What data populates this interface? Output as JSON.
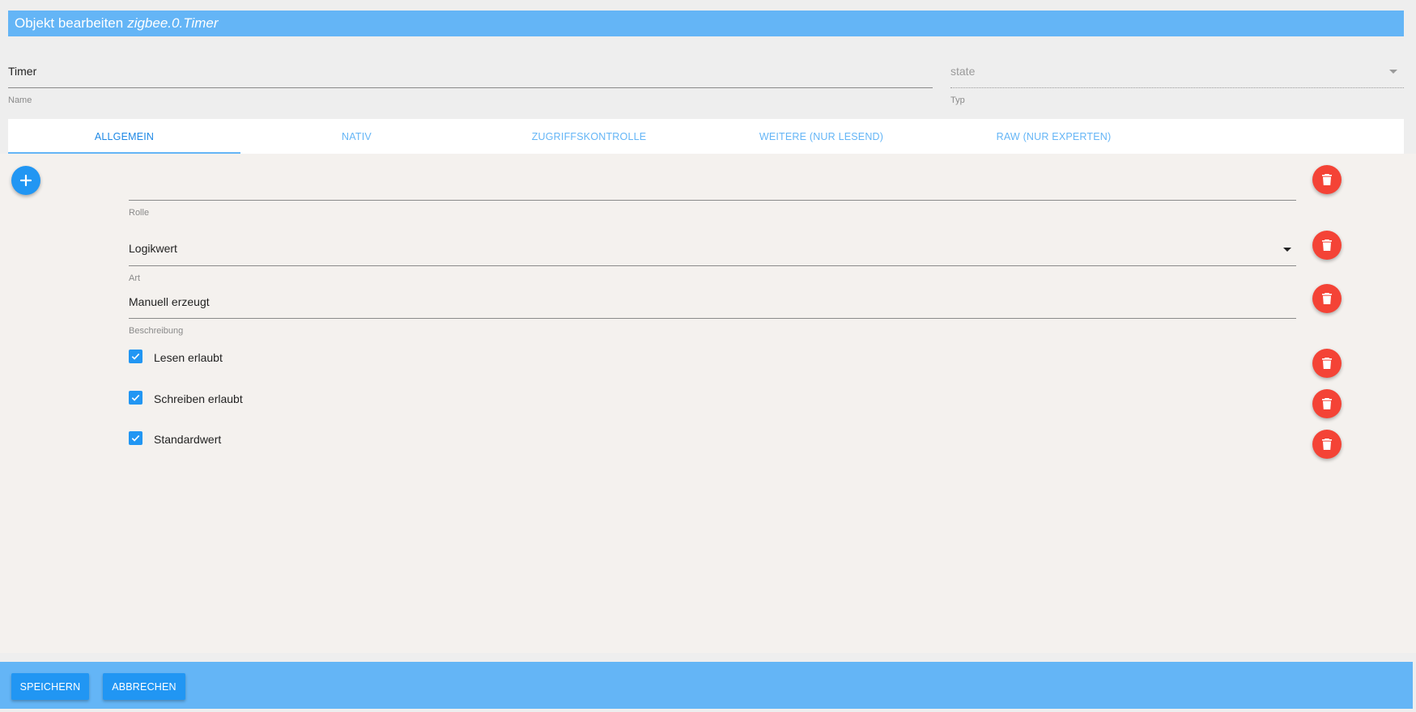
{
  "dialog": {
    "title_prefix": "Objekt bearbeiten",
    "object_id": "zigbee.0.Timer"
  },
  "name_field": {
    "value": "Timer",
    "label": "Name"
  },
  "type_field": {
    "value": "state",
    "label": "Typ"
  },
  "tabs": [
    {
      "label": "ALLGEMEIN",
      "active": true
    },
    {
      "label": "NATIV",
      "active": false
    },
    {
      "label": "ZUGRIFFSKONTROLLE",
      "active": false
    },
    {
      "label": "WEITERE (NUR LESEND)",
      "active": false
    },
    {
      "label": "RAW (NUR EXPERTEN)",
      "active": false
    }
  ],
  "general": {
    "role": {
      "value": "",
      "label": "Rolle"
    },
    "type": {
      "value": "Logikwert",
      "label": "Art"
    },
    "description": {
      "value": "Manuell erzeugt",
      "label": "Beschreibung"
    },
    "checkboxes": [
      {
        "label": "Lesen erlaubt",
        "checked": true
      },
      {
        "label": "Schreiben erlaubt",
        "checked": true
      },
      {
        "label": "Standardwert",
        "checked": true
      }
    ]
  },
  "footer": {
    "save_label": "SPEICHERN",
    "cancel_label": "ABBRECHEN"
  },
  "colors": {
    "primary_light": "#64b5f6",
    "primary": "#2196f3",
    "delete": "#f44336"
  }
}
